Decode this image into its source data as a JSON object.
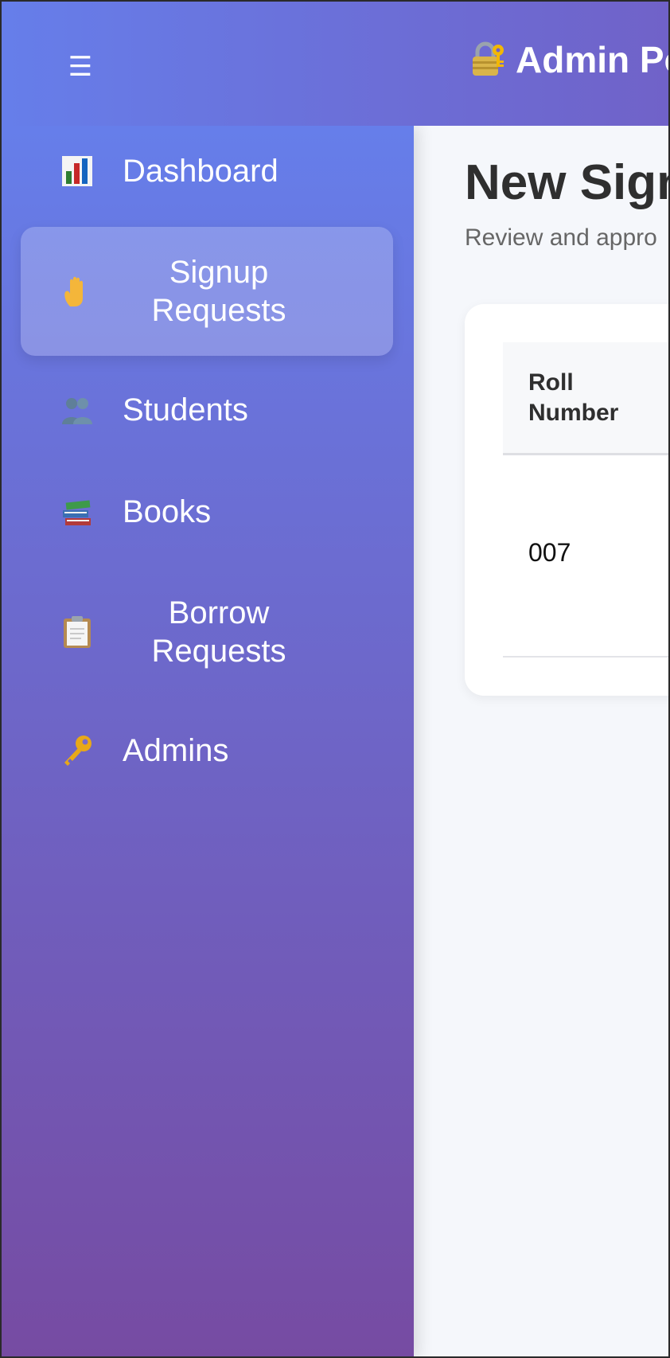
{
  "header": {
    "menu_icon": "hamburger-icon",
    "brand_icon": "lock-with-key-icon",
    "title": "Admin Po"
  },
  "sidebar": {
    "items": [
      {
        "label": "Dashboard",
        "icon": "bar-chart-icon",
        "active": false
      },
      {
        "label": "Signup Requests",
        "icon": "raised-hand-icon",
        "active": true
      },
      {
        "label": "Students",
        "icon": "people-icon",
        "active": false
      },
      {
        "label": "Books",
        "icon": "books-icon",
        "active": false
      },
      {
        "label": "Borrow Requests",
        "icon": "clipboard-icon",
        "active": false
      },
      {
        "label": "Admins",
        "icon": "key-icon",
        "active": false
      }
    ]
  },
  "main": {
    "title": "New Sign",
    "subtitle": "Review and appro",
    "table": {
      "columns": [
        "Roll Number"
      ],
      "rows": [
        [
          "007"
        ]
      ]
    }
  },
  "colors": {
    "sidebar_top": "#667eea",
    "sidebar_bottom": "#764ba2",
    "page_background": "#f5f7fb"
  }
}
